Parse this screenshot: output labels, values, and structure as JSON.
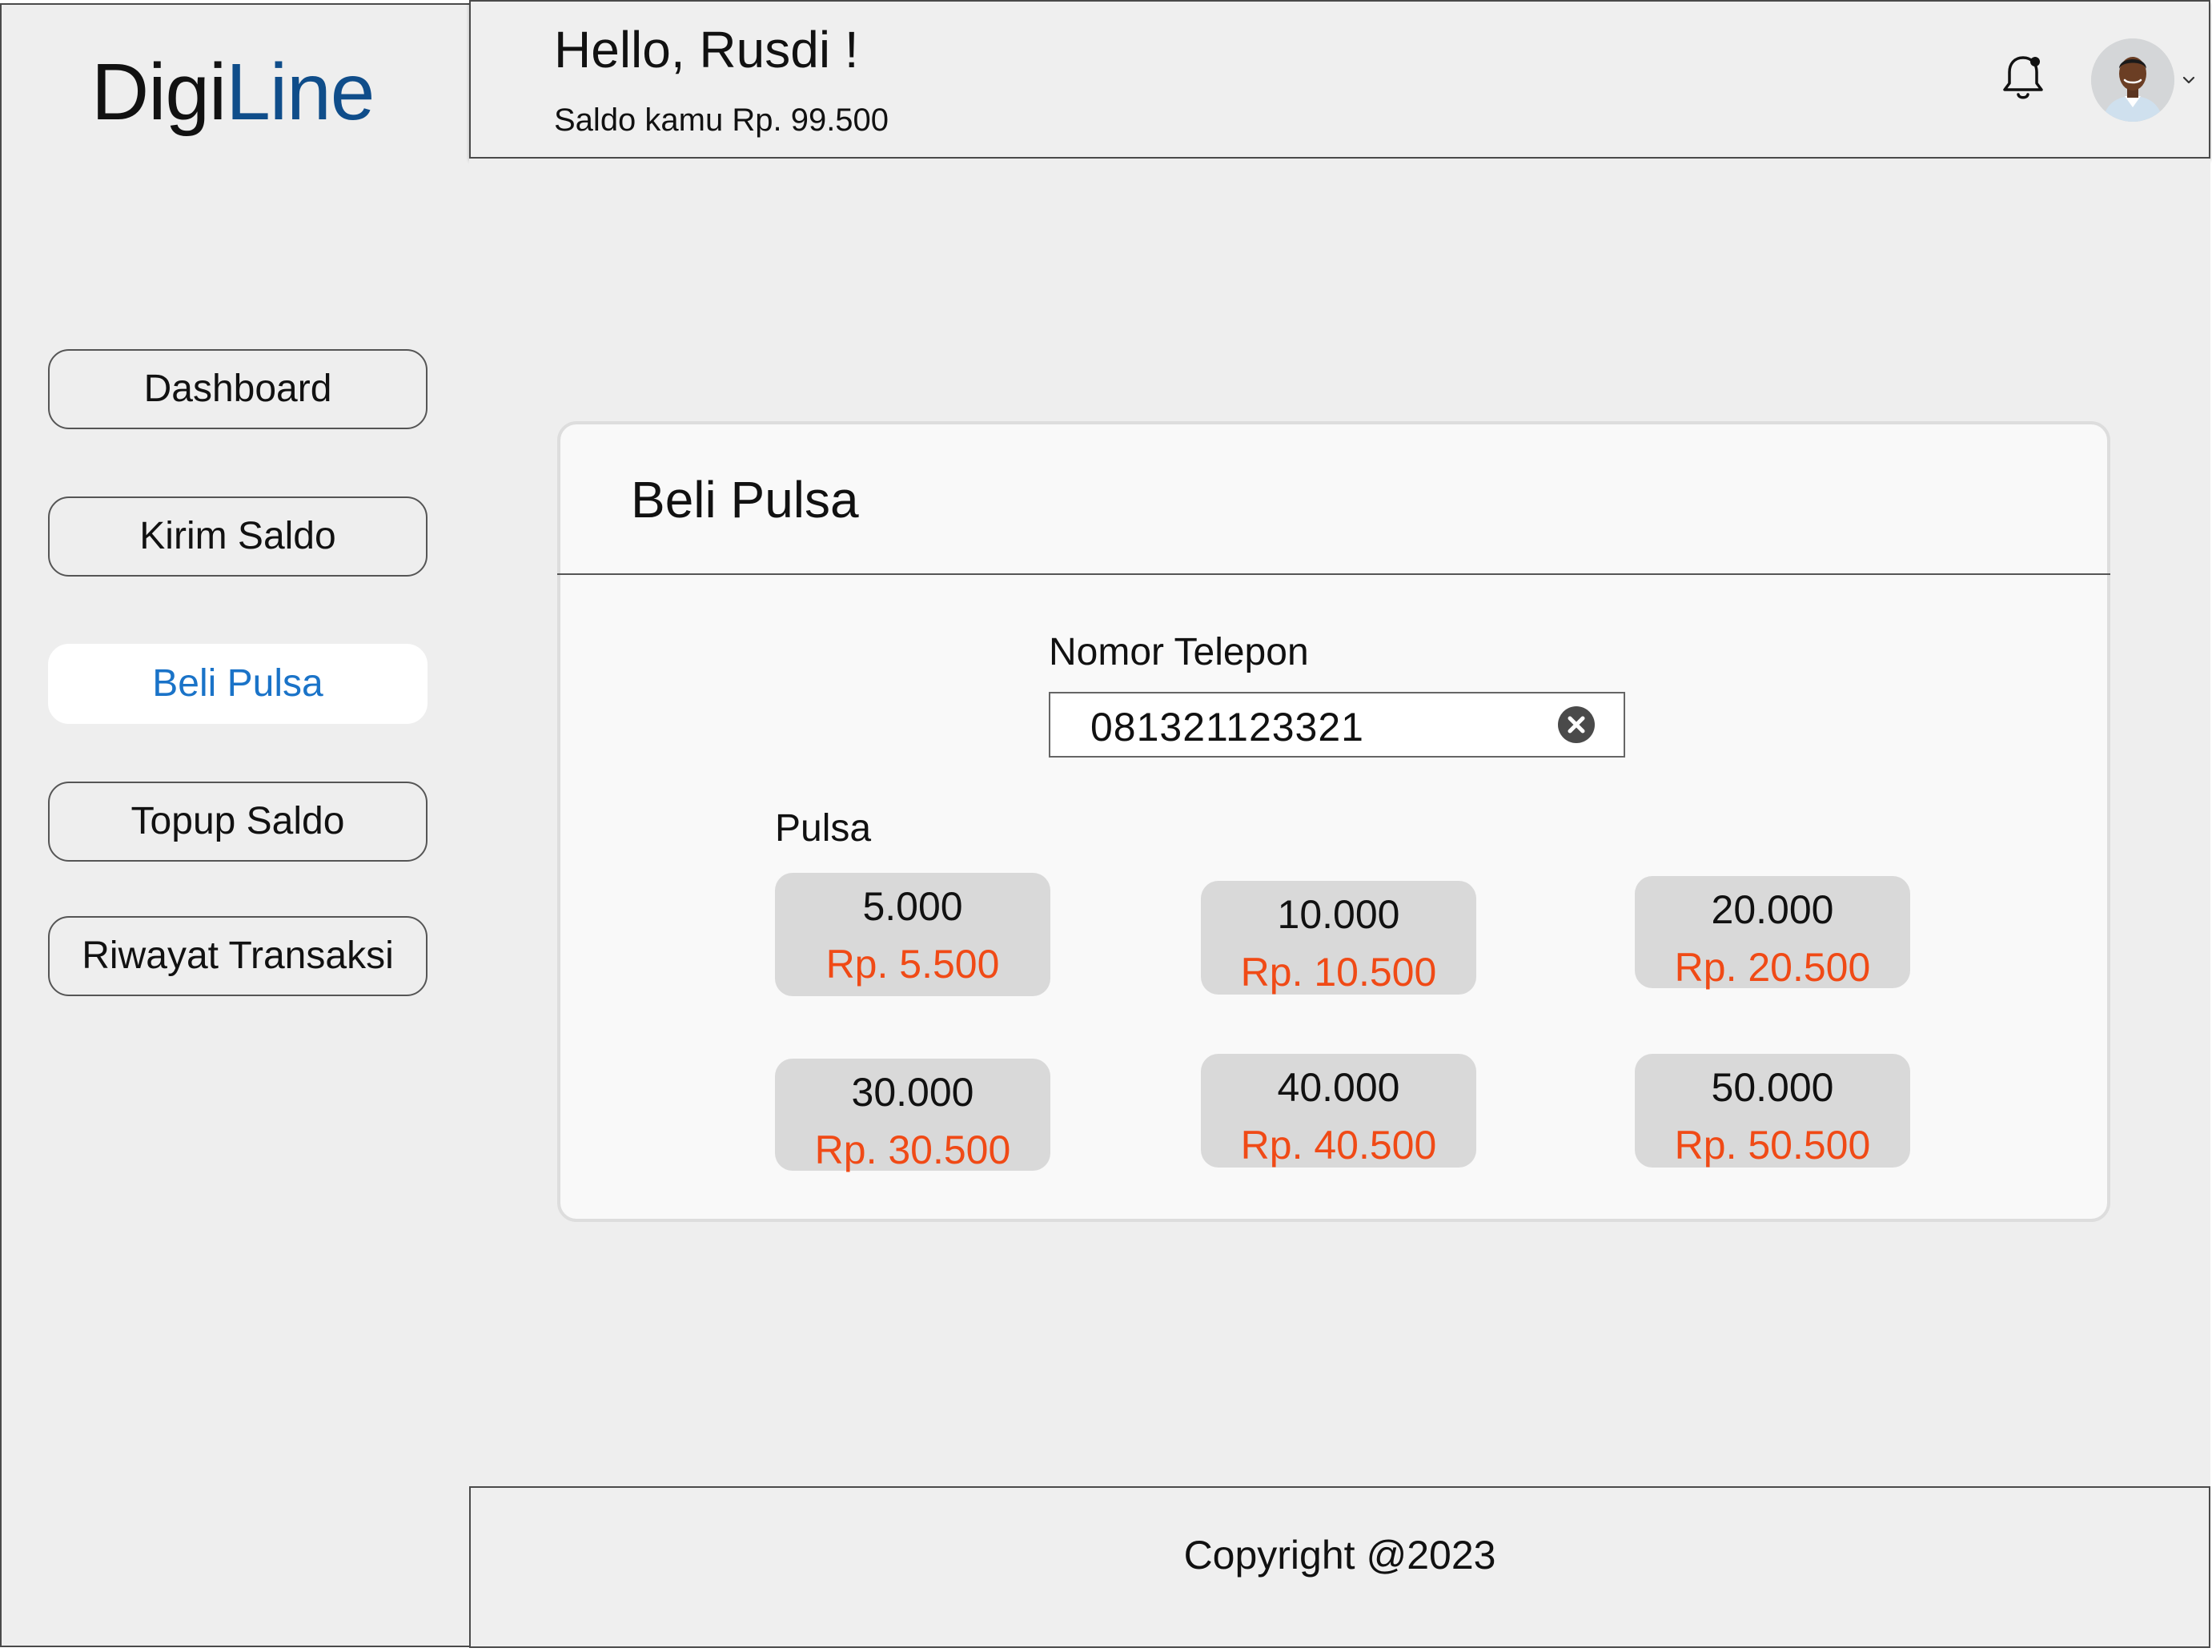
{
  "brand": {
    "part1": "Digi",
    "part2": "Line"
  },
  "sidebar": {
    "items": [
      {
        "label": "Dashboard"
      },
      {
        "label": "Kirim Saldo"
      },
      {
        "label": "Beli Pulsa"
      },
      {
        "label": "Topup Saldo"
      },
      {
        "label": "Riwayat Transaksi"
      }
    ],
    "active_item": "Beli Pulsa"
  },
  "header": {
    "greeting": "Hello, Rusdi !",
    "balance": "Saldo kamu Rp. 99.500",
    "icons": [
      "bell-icon",
      "avatar",
      "chevron-down-icon"
    ]
  },
  "card": {
    "title": "Beli Pulsa",
    "phone_label": "Nomor Telepon",
    "phone_value": "081321123321",
    "pulsa_label": "Pulsa",
    "options": [
      {
        "amount": "5.000",
        "price": "Rp. 5.500"
      },
      {
        "amount": "10.000",
        "price": "Rp. 10.500"
      },
      {
        "amount": "20.000",
        "price": "Rp. 20.500"
      },
      {
        "amount": "30.000",
        "price": "Rp. 30.500"
      },
      {
        "amount": "40.000",
        "price": "Rp. 40.500"
      },
      {
        "amount": "50.000",
        "price": "Rp. 50.500"
      }
    ]
  },
  "footer": {
    "copyright": "Copyright @2023"
  },
  "colors": {
    "brand_accent": "#0f4d8a",
    "active_nav_text": "#1a73c8",
    "price_text": "#f04a16",
    "option_bg": "#d9d9d9",
    "page_bg": "#eeeeee"
  }
}
